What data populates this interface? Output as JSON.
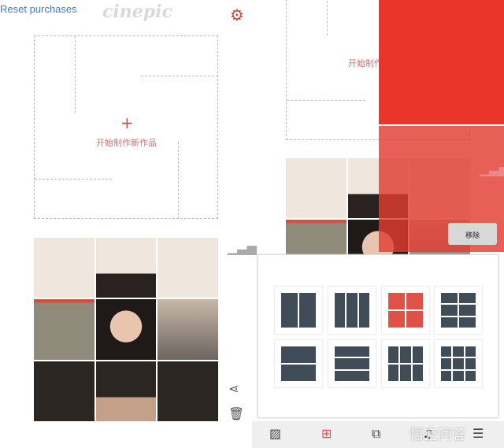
{
  "header": {
    "reset_label": "Reset purchases",
    "logo": "cinepic",
    "settings_icon": "gear-icon"
  },
  "new_project": {
    "plus": "+",
    "label": "开始制作新作品"
  },
  "context_menu": {
    "remove_label": "移除"
  },
  "layouts": {
    "selected_index": 2,
    "items": [
      {
        "name": "two-columns",
        "cols": 2,
        "rows": 1
      },
      {
        "name": "three-columns",
        "cols": 3,
        "rows": 1
      },
      {
        "name": "grid-2x2",
        "cols": 2,
        "rows": 2
      },
      {
        "name": "grid-2x3",
        "cols": 2,
        "rows": 3
      },
      {
        "name": "two-rows",
        "cols": 1,
        "rows": 2
      },
      {
        "name": "three-rows",
        "cols": 1,
        "rows": 3
      },
      {
        "name": "grid-3x2",
        "cols": 3,
        "rows": 2
      },
      {
        "name": "grid-3x3",
        "cols": 3,
        "rows": 3
      }
    ]
  },
  "colors": {
    "accent": "#e05249",
    "red_overlay": "#e9352a",
    "tile": "#404c58",
    "link": "#3a7bd5"
  },
  "toolbar": {
    "icons": [
      "texture-icon",
      "grid-icon",
      "overlay-icon",
      "music-icon",
      "adjust-icon"
    ]
  },
  "watermark": "悟空问答"
}
